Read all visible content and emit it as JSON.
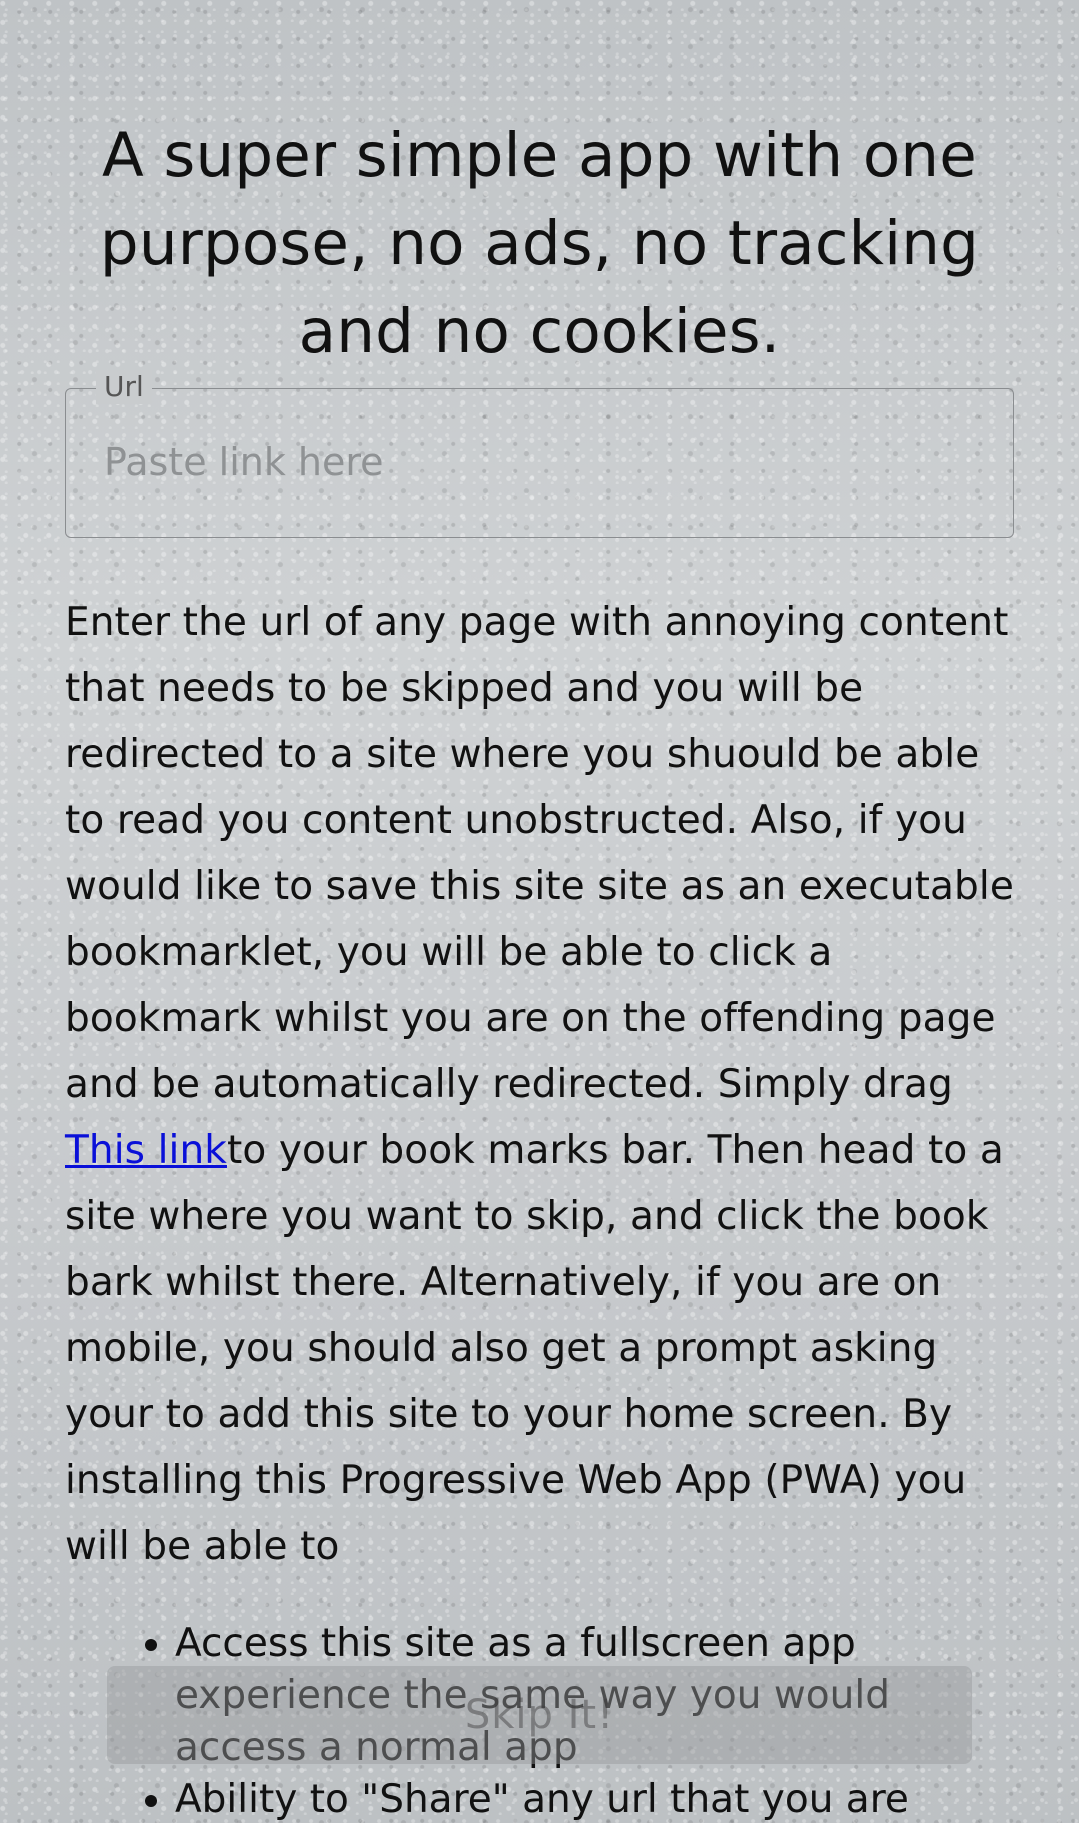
{
  "header": {
    "headline": "A super simple app with one purpose, no ads, no tracking and no cookies."
  },
  "url_field": {
    "label": "Url",
    "placeholder": "Paste link here",
    "value": ""
  },
  "description": {
    "before_link": "Enter the url of any page with annoying content that needs to be skipped and you will be redirected to a site where you shuould be able to read you content unobstructed. Also, if you would like to save this site site as an executable bookmarklet, you will be able to click a bookmark whilst you are on the offending page and be automatically redirected. Simply drag ",
    "link_text": "This link",
    "after_link": "to your book marks bar. Then head to a site where you want to skip, and click the book bark whilst there. Alternatively, if you are on mobile, you should also get a prompt asking your to add this site to your home screen. By installing this Progressive Web App (PWA) you will be able to"
  },
  "features": [
    "Access this site as a fullscreen app experience the same way you would access a normal app",
    "Ability to \"Share\" any url that you are"
  ],
  "skip_button": {
    "label": "Skip It!"
  }
}
